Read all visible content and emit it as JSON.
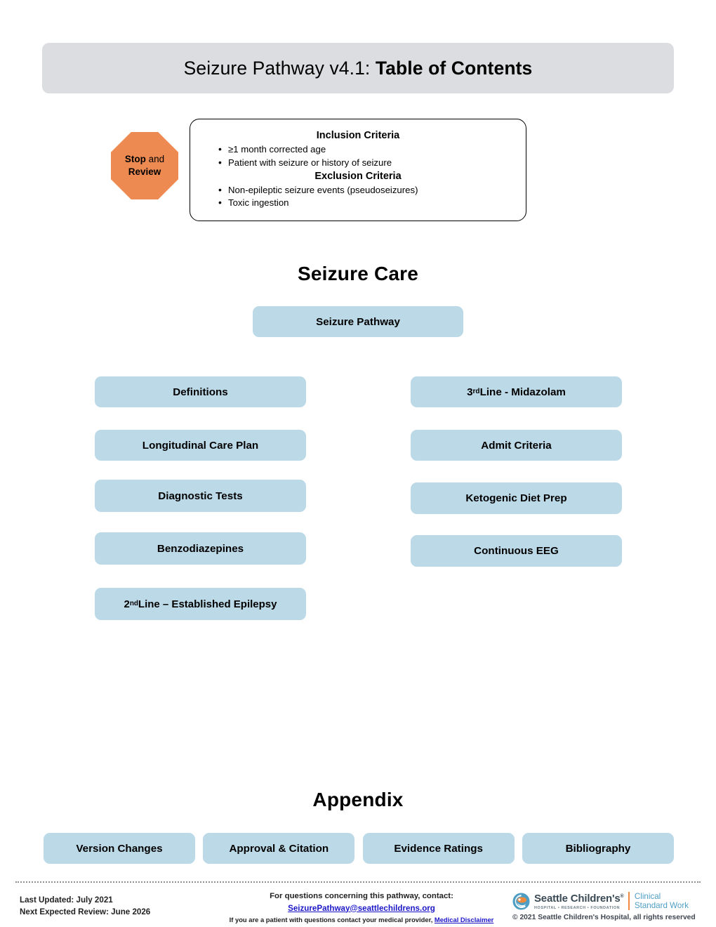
{
  "header": {
    "title_normal": "Seizure Pathway v4.1: ",
    "title_bold": "Table of Contents"
  },
  "stop_review": {
    "bold_word": "Stop",
    "rest_line1": " and",
    "line2": "Review",
    "icon": "octagon-stop-icon"
  },
  "criteria": {
    "inclusion_heading": "Inclusion Criteria",
    "inclusion_items": [
      "≥1 month corrected age",
      "Patient with seizure or history of seizure"
    ],
    "exclusion_heading": "Exclusion Criteria",
    "exclusion_items": [
      "Non-epileptic seizure events (pseudoseizures)",
      "Toxic ingestion"
    ]
  },
  "sections": {
    "seizure_care_heading": "Seizure Care",
    "appendix_heading": "Appendix"
  },
  "buttons": {
    "seizure_pathway": "Seizure Pathway",
    "definitions": "Definitions",
    "longitudinal_care_plan": "Longitudinal Care Plan",
    "diagnostic_tests": "Diagnostic Tests",
    "benzodiazepines": "Benzodiazepines",
    "second_line_pre": "2",
    "second_line_sup": "nd",
    "second_line_post": " Line – Established Epilepsy",
    "third_line_pre": "3",
    "third_line_sup": "rd",
    "third_line_post": " Line - Midazolam",
    "admit_criteria": "Admit Criteria",
    "ketogenic_diet_prep": "Ketogenic Diet Prep",
    "continuous_eeg": "Continuous EEG"
  },
  "appendix_buttons": [
    {
      "label": "Version Changes"
    },
    {
      "label": "Approval & Citation"
    },
    {
      "label": "Evidence Ratings"
    },
    {
      "label": "Bibliography"
    }
  ],
  "footer": {
    "last_updated": "Last Updated: July 2021",
    "next_review": "Next Expected Review: June 2026",
    "contact_prompt": "For questions concerning this pathway, contact:",
    "contact_email": "SeizurePathway@seattlechildrens.org",
    "disclaimer_prefix": "If you are a patient with questions contact your medical provider, ",
    "disclaimer_link": "Medical Disclaimer",
    "logo_brand": "Seattle Children's",
    "logo_sub": "HOSPITAL • RESEARCH • FOUNDATION",
    "logo_tagline_line1": "Clinical",
    "logo_tagline_line2": "Standard Work",
    "copyright": "© 2021 Seattle Children's Hospital, all rights reserved"
  },
  "colors": {
    "header_gray": "#dcdde0",
    "pill_blue": "#bcd9e8",
    "octagon_orange": "#ed8a52",
    "link_blue": "#1a16c8",
    "logo_teal": "#4e9ec4",
    "logo_orange": "#f08a3c"
  }
}
